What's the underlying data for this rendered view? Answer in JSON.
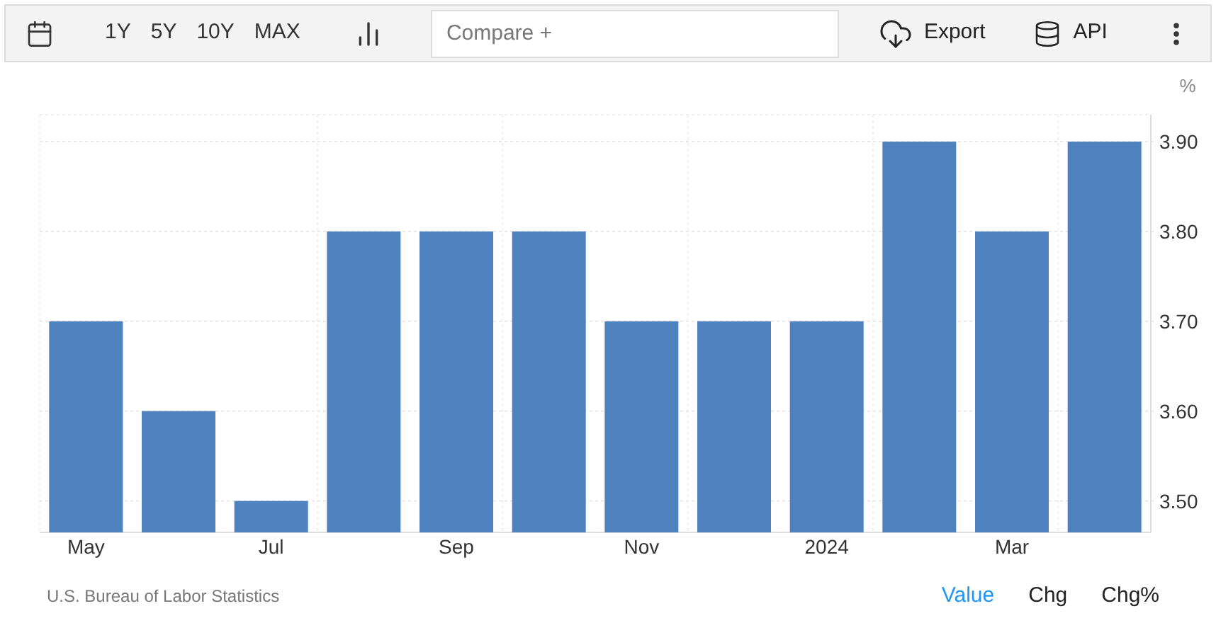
{
  "toolbar": {
    "ranges": [
      {
        "label": "1Y",
        "selected": false
      },
      {
        "label": "5Y",
        "selected": false
      },
      {
        "label": "10Y",
        "selected": false
      },
      {
        "label": "MAX",
        "selected": false
      }
    ],
    "compare": {
      "placeholder": "Compare +"
    },
    "export": "Export",
    "api": "API"
  },
  "chart": {
    "unit": "%",
    "chart_data": {
      "type": "bar",
      "categories": [
        "May",
        null,
        "Jul",
        null,
        "Sep",
        null,
        "Nov",
        null,
        "2024",
        null,
        "Mar",
        null
      ],
      "series": [
        {
          "color": "#4e81bd",
          "values": [
            3.7,
            3.6,
            3.5,
            3.8,
            3.8,
            3.8,
            3.7,
            3.7,
            3.7,
            3.9,
            3.8,
            3.9
          ]
        }
      ],
      "ylim": [
        3.465,
        3.93
      ],
      "grid": true,
      "yticks": [
        {
          "value": 3.5,
          "label": "3.50"
        },
        {
          "value": 3.6,
          "label": "3.60"
        },
        {
          "value": 3.7,
          "label": "3.70"
        },
        {
          "value": 3.8,
          "label": "3.80"
        },
        {
          "value": 3.9,
          "label": "3.90"
        }
      ]
    }
  },
  "source": "U.S. Bureau of Labor Statistics",
  "modes": [
    {
      "label": "Value",
      "selected": true
    },
    {
      "label": "Chg",
      "selected": false
    },
    {
      "label": "Chg%",
      "selected": false
    }
  ]
}
